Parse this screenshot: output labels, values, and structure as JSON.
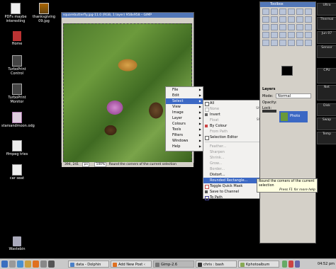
{
  "desktop_icons": [
    {
      "label": "PDFs maybe interesting",
      "icon": "pdf-document-icon"
    },
    {
      "label": "thanksgiving 09.jpg",
      "icon": "image-thumbnail-icon"
    },
    {
      "label": "Home",
      "icon": "home-folder-icon"
    },
    {
      "label": "TurboPrint Control",
      "icon": "printer-icon"
    },
    {
      "label": "TurboPrint Monitor",
      "icon": "monitor-icon"
    },
    {
      "label": "starsandmoon.odg",
      "icon": "drawing-document-icon"
    },
    {
      "label": "ffmpeg tries",
      "icon": "document-icon"
    },
    {
      "label": "car seat",
      "icon": "document-icon"
    },
    {
      "label": "Wastebin",
      "icon": "trash-icon"
    }
  ],
  "gimp": {
    "title": "squarebutterfly.jpg-11.0 (RGB, 1 layer) 958x958 – GIMP",
    "status": {
      "coords": "394, 241",
      "unit": "px",
      "zoom": "100%",
      "message": "Round the corners of the current selection"
    }
  },
  "main_menu": [
    {
      "label": "File"
    },
    {
      "label": "Edit"
    },
    {
      "label": "Select"
    },
    {
      "label": "View"
    },
    {
      "label": "Image"
    },
    {
      "label": "Layer"
    },
    {
      "label": "Colours"
    },
    {
      "label": "Tools"
    },
    {
      "label": "Filters"
    },
    {
      "label": "Windows"
    },
    {
      "label": "Help"
    }
  ],
  "select_menu": [
    {
      "label": "All",
      "shortcut": "Ctrl+A"
    },
    {
      "label": "None",
      "shortcut": "Shift+Ctrl+A"
    },
    {
      "label": "Invert",
      "shortcut": "Ctrl+I"
    },
    {
      "label": "Float",
      "shortcut": "Shift+Ctrl+L"
    },
    {
      "label": "By Colour",
      "shortcut": "Shift+O"
    },
    {
      "label": "From Path",
      "shortcut": "Shift+V"
    },
    {
      "label": "Selection Editor",
      "shortcut": ""
    },
    {
      "label": "Feather...",
      "shortcut": ""
    },
    {
      "label": "Sharpen",
      "shortcut": ""
    },
    {
      "label": "Shrink...",
      "shortcut": ""
    },
    {
      "label": "Grow...",
      "shortcut": ""
    },
    {
      "label": "Border...",
      "shortcut": ""
    },
    {
      "label": "Distort...",
      "shortcut": ""
    },
    {
      "label": "Rounded Rectangle...",
      "shortcut": ""
    },
    {
      "label": "Toggle Quick Mask",
      "shortcut": "Shift+Q"
    },
    {
      "label": "Save to Channel",
      "shortcut": ""
    },
    {
      "label": "To Path",
      "shortcut": ""
    }
  ],
  "tooltip": {
    "text": "Round the corners of the current selection",
    "hint": "Press F1 for more help"
  },
  "toolbox": {
    "title": "Toolbox",
    "layers_title": "Layers",
    "mode_label": "Mode:",
    "mode_value": "Normal",
    "opacity_label": "Opacity:",
    "lock_label": "Lock:",
    "layer_name": "Photo"
  },
  "shelf_labels": [
    "Ultra",
    "Thermal",
    "Jun 07",
    "Sensor",
    "CPU",
    "Net",
    "Disk",
    "Swap",
    "Temp"
  ],
  "taskbar": {
    "tasks": [
      {
        "label": "data - Dolphin"
      },
      {
        "label": "Add New Post ‹"
      },
      {
        "label": "Gimp-2.6"
      },
      {
        "label": "chris : bash"
      },
      {
        "label": "Kphotoalbum"
      }
    ],
    "clock": "04:52 pm"
  }
}
